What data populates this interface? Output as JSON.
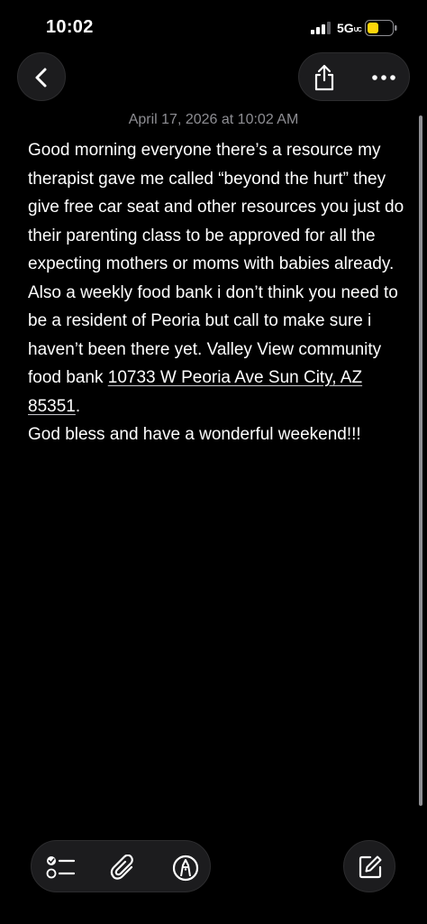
{
  "status_bar": {
    "time": "10:02",
    "network": "5G",
    "network_suffix": "UC"
  },
  "icons": {
    "back": "chevron-left-icon",
    "share": "share-icon",
    "more": "ellipsis-icon",
    "checklist": "checklist-icon",
    "attachment": "paperclip-icon",
    "markup": "markup-pen-icon",
    "compose": "compose-icon"
  },
  "colors": {
    "background": "#000000",
    "button_fill": "#1c1c1e",
    "secondary_text": "#8e8e93",
    "battery_fill": "#ffd60a"
  },
  "note": {
    "date": "April 17, 2026 at 10:02 AM",
    "paragraph1": "Good morning everyone there’s a resource my therapist gave me called “beyond the hurt” they give free car seat and other resources you just do their parenting class to be approved for all the expecting mothers or moms with babies already.",
    "paragraph2_before": "Also a weekly food bank i don’t think you need to be a resident of Peoria but call to make sure i haven’t been there yet. Valley View community food bank ",
    "paragraph2_address": "10733 W Peoria Ave Sun City, AZ 85351",
    "paragraph2_after": ".",
    "paragraph3": "God bless and have a wonderful weekend!!!"
  }
}
